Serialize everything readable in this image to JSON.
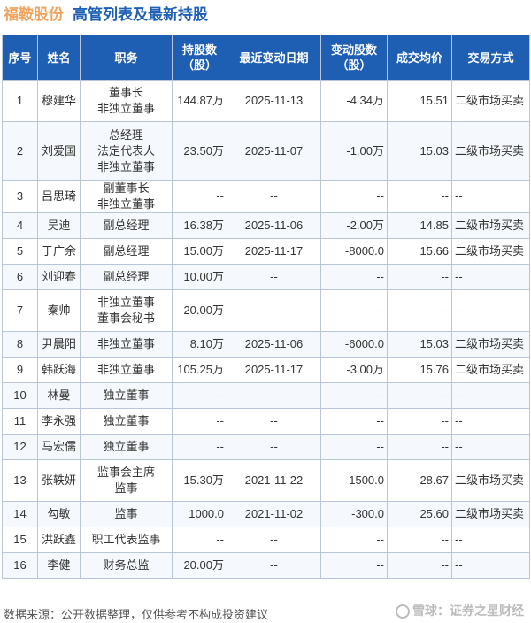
{
  "title": {
    "company": "福鞍股份",
    "subtitle": "高管列表及最新持股"
  },
  "headers": [
    "序号",
    "姓名",
    "职务",
    "持股数\n（股）",
    "最近变动日期",
    "变动股数\n（股）",
    "成交均价",
    "交易方式"
  ],
  "rows": [
    {
      "no": "1",
      "name": "穆建华",
      "role": [
        "董事长",
        "非独立董事"
      ],
      "shares": "144.87万",
      "date": "2025-11-13",
      "change": "-4.34万",
      "price": "15.51",
      "method": "二级市场买卖"
    },
    {
      "no": "2",
      "name": "刘爱国",
      "role": [
        "总经理",
        "法定代表人",
        "非独立董事"
      ],
      "shares": "23.50万",
      "date": "2025-11-07",
      "change": "-1.00万",
      "price": "15.03",
      "method": "二级市场买卖"
    },
    {
      "no": "3",
      "name": "吕思琦",
      "role": [
        "副董事长",
        "非独立董事"
      ],
      "shares": "--",
      "date": "--",
      "change": "--",
      "price": "--",
      "method": "--"
    },
    {
      "no": "4",
      "name": "吴迪",
      "role": [
        "副总经理"
      ],
      "shares": "16.38万",
      "date": "2025-11-06",
      "change": "-2.00万",
      "price": "14.85",
      "method": "二级市场买卖"
    },
    {
      "no": "5",
      "name": "于广余",
      "role": [
        "副总经理"
      ],
      "shares": "15.00万",
      "date": "2025-11-17",
      "change": "-8000.0",
      "price": "15.66",
      "method": "二级市场买卖"
    },
    {
      "no": "6",
      "name": "刘迎春",
      "role": [
        "副总经理"
      ],
      "shares": "10.00万",
      "date": "--",
      "change": "--",
      "price": "--",
      "method": "--"
    },
    {
      "no": "7",
      "name": "秦帅",
      "role": [
        "非独立董事",
        "董事会秘书"
      ],
      "shares": "20.00万",
      "date": "--",
      "change": "--",
      "price": "--",
      "method": "--"
    },
    {
      "no": "8",
      "name": "尹晨阳",
      "role": [
        "非独立董事"
      ],
      "shares": "8.10万",
      "date": "2025-11-06",
      "change": "-6000.0",
      "price": "15.03",
      "method": "二级市场买卖"
    },
    {
      "no": "9",
      "name": "韩跃海",
      "role": [
        "非独立董事"
      ],
      "shares": "105.25万",
      "date": "2025-11-17",
      "change": "-3.00万",
      "price": "15.76",
      "method": "二级市场买卖"
    },
    {
      "no": "10",
      "name": "林曼",
      "role": [
        "独立董事"
      ],
      "shares": "--",
      "date": "--",
      "change": "--",
      "price": "--",
      "method": "--"
    },
    {
      "no": "11",
      "name": "李永强",
      "role": [
        "独立董事"
      ],
      "shares": "--",
      "date": "--",
      "change": "--",
      "price": "--",
      "method": "--"
    },
    {
      "no": "12",
      "name": "马宏儒",
      "role": [
        "独立董事"
      ],
      "shares": "--",
      "date": "--",
      "change": "--",
      "price": "--",
      "method": "--"
    },
    {
      "no": "13",
      "name": "张轶妍",
      "role": [
        "监事会主席",
        "监事"
      ],
      "shares": "15.30万",
      "date": "2021-11-22",
      "change": "-1500.0",
      "price": "28.67",
      "method": "二级市场买卖"
    },
    {
      "no": "14",
      "name": "勾敏",
      "role": [
        "监事"
      ],
      "shares": "1000.0",
      "date": "2021-11-02",
      "change": "-300.0",
      "price": "25.60",
      "method": "二级市场买卖"
    },
    {
      "no": "15",
      "name": "洪跃鑫",
      "role": [
        "职工代表监事"
      ],
      "shares": "--",
      "date": "--",
      "change": "--",
      "price": "--",
      "method": "--"
    },
    {
      "no": "16",
      "name": "李健",
      "role": [
        "财务总监"
      ],
      "shares": "20.00万",
      "date": "--",
      "change": "--",
      "price": "--",
      "method": "--"
    }
  ],
  "row_heights": [],
  "footer": "数据来源：公开数据整理，仅供参考不构成投资建议",
  "brand": "雪球：证券之星财经",
  "colors": {
    "header_bg": "#1e5fb4",
    "company": "#f0a35c",
    "subtitle": "#1e5fb4",
    "change": "#1a9a1a"
  }
}
